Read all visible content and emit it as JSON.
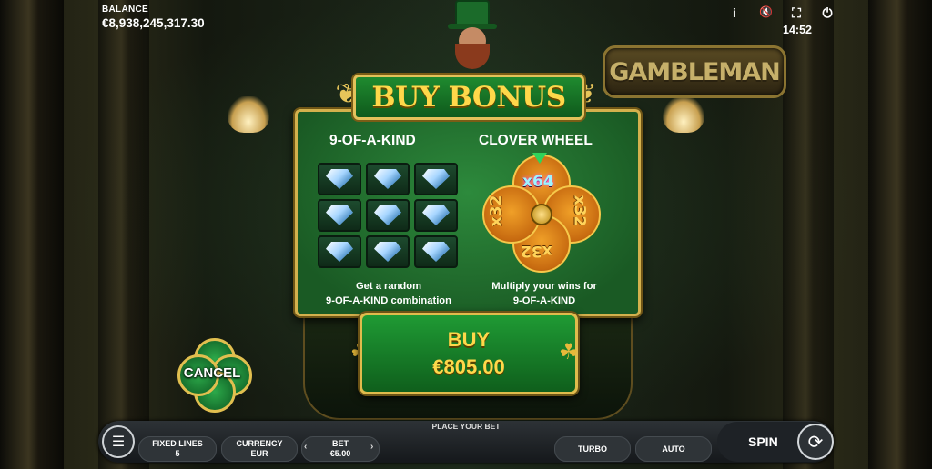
{
  "hud": {
    "balance_label": "BALANCE",
    "balance_value": "€8,938,245,317.30",
    "clock": "14:52",
    "icons": [
      "info-icon",
      "mute-icon",
      "fullscreen-icon",
      "power-icon"
    ],
    "info_glyph": "i",
    "mute_glyph": "🔇",
    "fullscreen_glyph": "⛶",
    "power_glyph": "⏻"
  },
  "logo": "GAMBLEMAN",
  "buy_bonus": {
    "title": "BUY BONUS",
    "left_section": {
      "title": "9-OF-A-KIND",
      "desc_line1": "Get a random",
      "desc_line2": "9-OF-A-KIND combination"
    },
    "right_section": {
      "title": "CLOVER WHEEL",
      "multipliers": [
        "x64",
        "x32",
        "x32",
        "x32"
      ],
      "desc_line1": "Multiply your wins for",
      "desc_line2": "9-OF-A-KIND"
    },
    "buy_label": "BUY",
    "buy_price": "€805.00",
    "cancel_label": "CANCEL"
  },
  "bottom_bar": {
    "place_bet": "PLACE YOUR BET",
    "fixed_lines_label": "FIXED LINES",
    "fixed_lines_value": "5",
    "currency_label": "CURRENCY",
    "currency_value": "EUR",
    "bet_label": "BET",
    "bet_value": "€5.00",
    "bet_prev": "‹",
    "bet_next": "›",
    "turbo_label": "TURBO",
    "auto_label": "AUTO",
    "spin_label": "SPIN",
    "menu_glyph": "☰",
    "spin_glyph": "⟳"
  },
  "colors": {
    "accent_gold": "#e0bb4c",
    "panel_green": "#1a5a24",
    "title_text": "#ffd84a"
  }
}
